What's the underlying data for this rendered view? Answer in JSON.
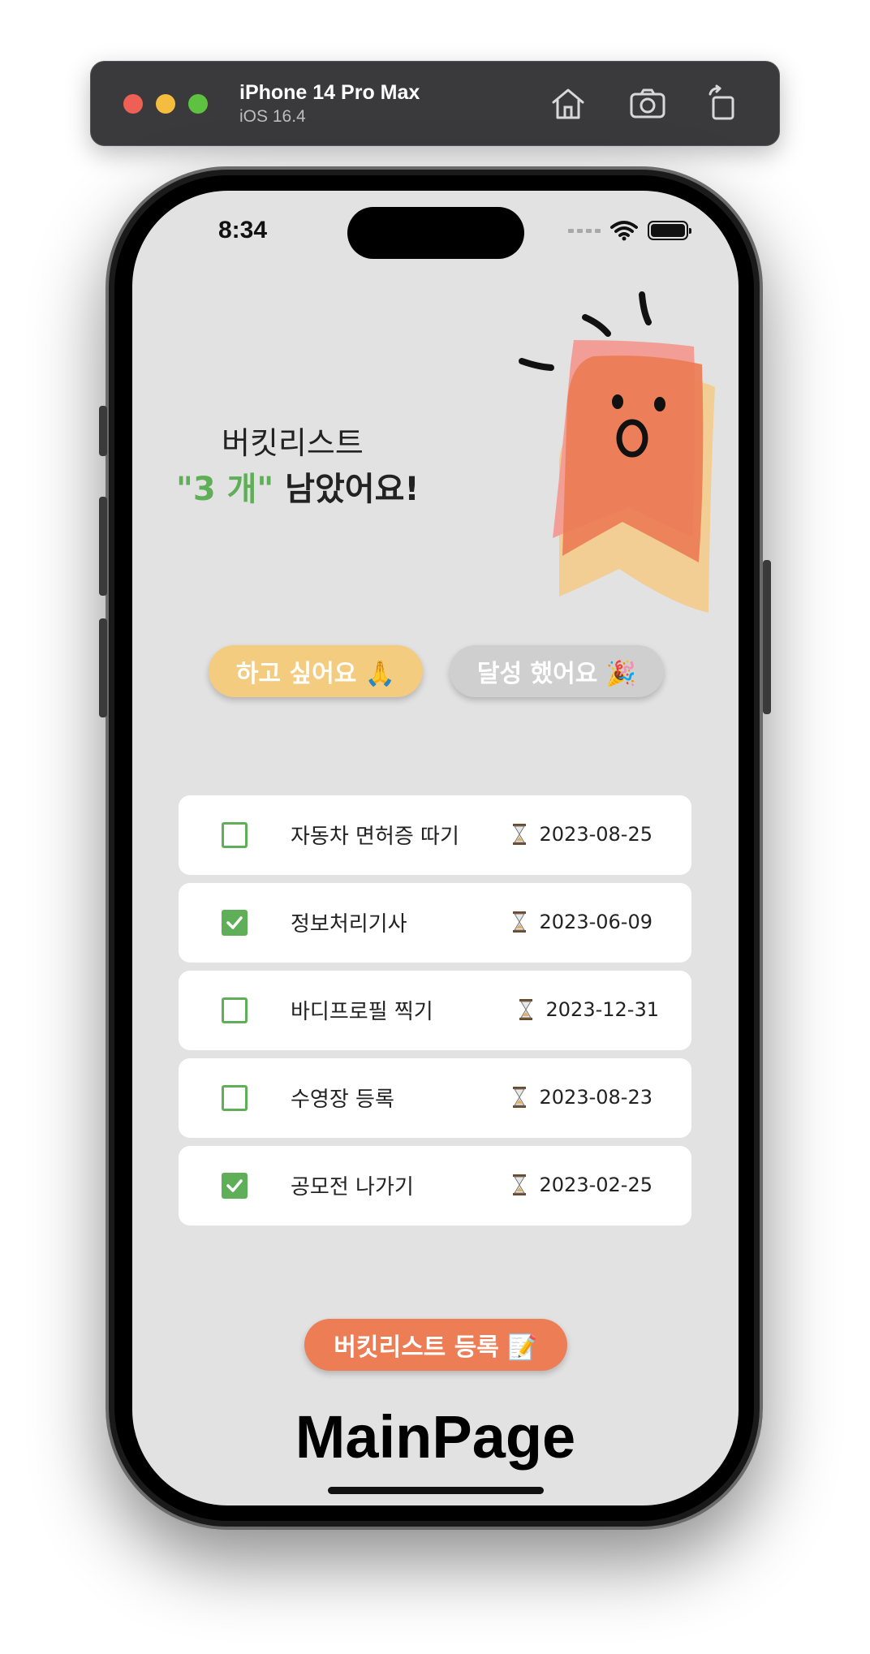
{
  "simulator": {
    "device_name": "iPhone 14 Pro Max",
    "os_version": "iOS 16.4",
    "toolbar_icons": [
      "home-icon",
      "screenshot-icon",
      "rotate-icon"
    ]
  },
  "status_bar": {
    "time": "8:34",
    "icons": [
      "cellular-signal-icon",
      "wifi-icon",
      "battery-icon"
    ]
  },
  "header": {
    "line1": "버킷리스트",
    "count": "\"3 개\"",
    "line2_suffix": " 남았어요!"
  },
  "filters": {
    "want_label": "하고 싶어요 🙏",
    "done_label": "달성 했어요 🎉"
  },
  "bucket_list": [
    {
      "title": "자동차 면허증 따기",
      "date": "2023-08-25",
      "checked": false
    },
    {
      "title": "정보처리기사",
      "date": "2023-06-09",
      "checked": true
    },
    {
      "title": "바디프로필 찍기",
      "date": "2023-12-31",
      "checked": false
    },
    {
      "title": "수영장 등록",
      "date": "2023-08-23",
      "checked": false
    },
    {
      "title": "공모전 나가기",
      "date": "2023-02-25",
      "checked": true
    }
  ],
  "register_button": "버킷리스트 등록 📝",
  "page_label": "MainPage",
  "colors": {
    "accent_green": "#5fae58",
    "want_pill": "#f3cc80",
    "done_pill": "#cfcfcf",
    "register": "#ec7d55",
    "screen_bg": "#e2e2e2"
  }
}
